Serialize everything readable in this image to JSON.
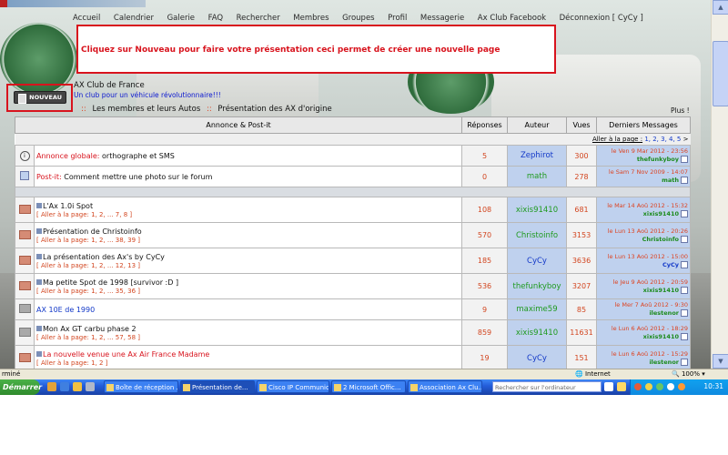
{
  "nav": [
    "Accueil",
    "Calendrier",
    "Galerie",
    "FAQ",
    "Rechercher",
    "Membres",
    "Groupes",
    "Profil",
    "Messagerie",
    "Ax Club Facebook",
    "Déconnexion [ CyCy ]"
  ],
  "notice": "Cliquez sur Nouveau pour faire votre présentation ceci permet de créer une nouvelle page",
  "nouveau_label": "NOUVEAU",
  "site": {
    "title": "AX Club de France",
    "subtitle": "Un club pour un véhicule révolutionnaire!!!"
  },
  "breadcrumb": {
    "sep": "::",
    "a": "Les membres et leurs Autos",
    "b": "Présentation des AX d'origine"
  },
  "plus": "Plus !",
  "table": {
    "headers": [
      "Annonce & Post-it",
      "Réponses",
      "Auteur",
      "Vues",
      "Derniers Messages"
    ],
    "pager_prefix": "Aller à la page :",
    "pager_pages": "1, 2, 3, 4, 5",
    "pager_next": ">",
    "pinned": [
      {
        "prefix": "Annonce globale:",
        "title": "orthographe et SMS",
        "replies": "5",
        "author": "Zephirot",
        "views": "300",
        "last_date": "le Ven 9 Mar 2012 - 23:56",
        "last_user": "thefunkyboy"
      },
      {
        "prefix": "Post-it:",
        "title": "Comment mettre une photo sur le forum",
        "replies": "0",
        "author": "math",
        "views": "278",
        "last_date": "le Sam 7 Nov 2009 - 14:07",
        "last_user": "math"
      }
    ],
    "topics": [
      {
        "title": "L'Ax 1.0i Spot",
        "pages": "[ Aller à la page: 1, 2, ... 7, 8 ]",
        "replies": "108",
        "author": "xixis91410",
        "views": "681",
        "last_date": "le Mar 14 Aoû 2012 - 15:32",
        "last_user": "xixis91410"
      },
      {
        "title": "Présentation de Christoinfo",
        "pages": "[ Aller à la page: 1, 2, ... 38, 39 ]",
        "replies": "570",
        "author": "Christoinfo",
        "views": "3153",
        "last_date": "le Lun 13 Aoû 2012 - 20:26",
        "last_user": "Christoinfo"
      },
      {
        "title": "La présentation des Ax's by CyCy",
        "pages": "[ Aller à la page: 1, 2, ... 12, 13 ]",
        "replies": "185",
        "author": "CyCy",
        "views": "3636",
        "last_date": "le Lun 13 Aoû 2012 - 15:00",
        "last_user": "CyCy"
      },
      {
        "title": "Ma petite Spot de 1998 [survivor :D ]",
        "pages": "[ Aller à la page: 1, 2, ... 35, 36 ]",
        "replies": "536",
        "author": "thefunkyboy",
        "views": "3207",
        "last_date": "le Jeu 9 Aoû 2012 - 20:59",
        "last_user": "xixis91410"
      },
      {
        "title": "AX 10E de 1990",
        "pages": "",
        "replies": "9",
        "author": "maxime59",
        "views": "85",
        "last_date": "le Mer 7 Aoû 2012 - 9:30",
        "last_user": "ilestenor"
      },
      {
        "title": "Mon Ax GT carbu phase 2",
        "pages": "[ Aller à la page: 1, 2, ... 57, 58 ]",
        "replies": "859",
        "author": "xixis91410",
        "views": "11631",
        "last_date": "le Lun 6 Aoû 2012 - 18:29",
        "last_user": "xixis91410"
      },
      {
        "title": "La nouvelle venue une Ax Air France Madame",
        "pages": "[ Aller à la page: 1, 2 ]",
        "replies": "19",
        "author": "CyCy",
        "views": "151",
        "last_date": "le Lun 6 Aoû 2012 - 15:29",
        "last_user": "ilestenor"
      }
    ]
  },
  "status": {
    "left": "rminé",
    "zone": "Internet",
    "zoom": "100%"
  },
  "taskbar": {
    "start": "Démarrer",
    "tasks": [
      "Boîte de réception ...",
      "Présentation de...",
      "Cisco IP Communic...",
      "2 Microsoft Offic...",
      "Association Ax Clu..."
    ],
    "search_placeholder": "Rechercher sur l'ordinateur",
    "clock": "10:31"
  }
}
